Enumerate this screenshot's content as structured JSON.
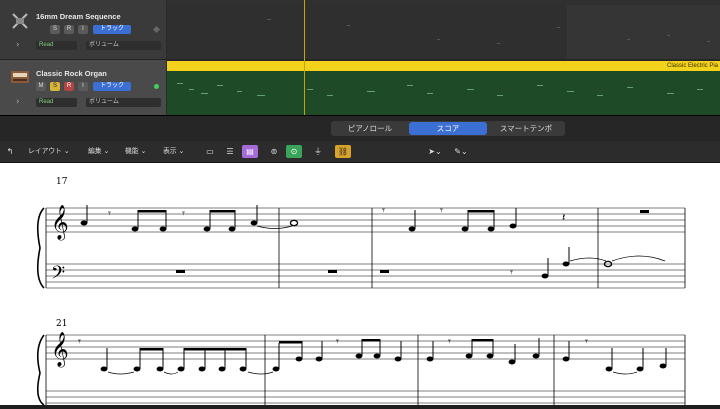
{
  "tracks": [
    {
      "name": "16mm Dream Sequence",
      "buttons": [
        "S",
        "R",
        "I"
      ],
      "type_label": "トラック",
      "input_label": "Read",
      "automation_label": "ボリューム"
    },
    {
      "name": "Classic Rock Organ",
      "buttons": [
        "M",
        "S",
        "R",
        "I"
      ],
      "type_label": "トラック",
      "input_label": "Read",
      "automation_label": "ボリューム"
    }
  ],
  "region_label": "Classic Electric Pia",
  "tabs": [
    "ピアノロール",
    "スコア",
    "スマートテンポ"
  ],
  "active_tab": "スコア",
  "toolbar": {
    "layout": "レイアウト",
    "edit": "編集",
    "functions": "機能",
    "view": "表示"
  },
  "score": {
    "measure_numbers": [
      "17",
      "21"
    ]
  },
  "colors": {
    "accent": "#3b6fd4",
    "region": "#f2d21b",
    "region_body": "#1f4a27",
    "playhead": "#c8a400"
  }
}
